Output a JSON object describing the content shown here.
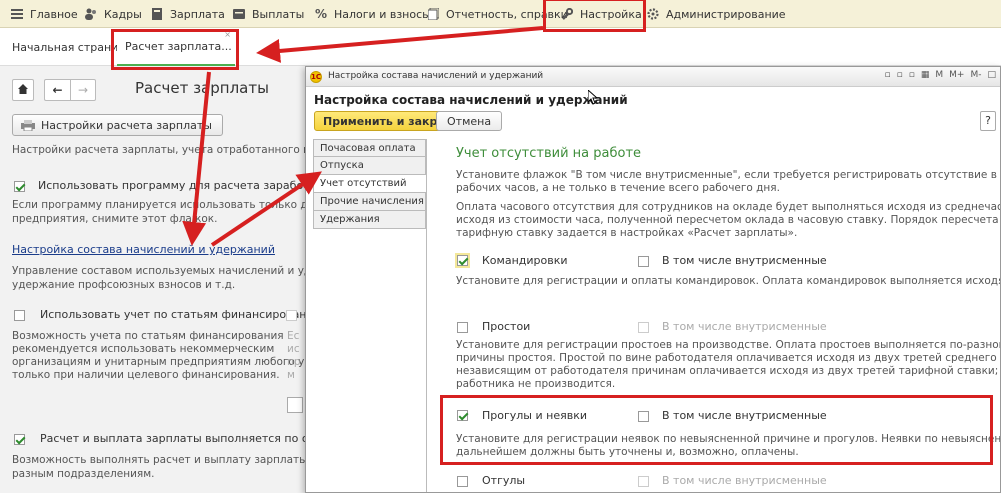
{
  "topmenu": {
    "items": [
      {
        "label": "Главное",
        "icon": "menu-icon"
      },
      {
        "label": "Кадры",
        "icon": "people-icon"
      },
      {
        "label": "Зарплата",
        "icon": "calculator-icon"
      },
      {
        "label": "Выплаты",
        "icon": "wallet-icon"
      },
      {
        "label": "Налоги и взносы",
        "icon": "percent-icon"
      },
      {
        "label": "Отчетность, справки",
        "icon": "report-icon"
      },
      {
        "label": "Настройка",
        "icon": "wrench-icon"
      },
      {
        "label": "Администрирование",
        "icon": "gear-icon"
      }
    ]
  },
  "tabs": {
    "home": "Начальная страница",
    "active": "Расчет зарплата..."
  },
  "leftpage": {
    "title": "Расчет зарплаты",
    "settings_button": "Настройки расчета зарплаты",
    "desc1": "Настройки расчета зарплаты, учета отработанного времени, отс",
    "cb1_label": "Использовать программу для расчета заработной плат",
    "cb1_hint1": "Если программу планируется использовать только для ведения к",
    "cb1_hint2": "предприятия, снимите этот флажок.",
    "link": "Настройка состава начислений и удержаний",
    "link_hint1": "Управление составом используемых начислений и удержаний, у",
    "link_hint2": "удержание профсоюзных взносов и т.д.",
    "cb2_label": "Использовать учет по статьям финансирования",
    "cb2_hint1": "Возможность учета по статьям финансирования",
    "cb2_hint2": "рекомендуется использовать некоммерческим",
    "cb2_hint3": "организациям и унитарным предприятиям любого уровня",
    "cb2_hint4": "только при наличии целевого финансирования.",
    "cb2_side1": "Ес",
    "cb2_side2": "ис",
    "cb2_side3": "пр",
    "cb2_side4": "м",
    "cb3_label": "Расчет и выплата зарплаты выполняется по организации в",
    "cb3_hint1": "Возможность выполнять расчет и выплату зарплаты по всей орга",
    "cb3_hint2": "разным подразделениям."
  },
  "dialog": {
    "window_title": "Настройка состава начислений и удержаний",
    "toolbar_icons": [
      "M",
      "M+",
      "M-"
    ],
    "header": "Настройка состава начислений и удержаний",
    "apply_button": "Применить и закрыть",
    "cancel_button": "Отмена",
    "help_button": "?",
    "sidetabs": [
      "Почасовая оплата",
      "Отпуска",
      "Учет отсутствий",
      "Прочие начисления",
      "Удержания"
    ],
    "section_title": "Учет отсутствий на работе",
    "intro1": "Установите флажок \"В том числе внутрисменные\", если требуется регистрировать отсутствие в течение нескольких",
    "intro2": "рабочих часов, а не только в течение всего рабочего дня.",
    "intro3": "Оплата часового отсутствия для сотрудников на окладе будет выполняться исходя из среднечасового заработка или",
    "intro4": "исходя из стоимости часа, полученной пересчетом оклада в часовую ставку. Порядок пересчета оклада в часовую",
    "intro5": "тарифную ставку задается в настройках «Расчет зарплаты».",
    "trips_label": "Командировки",
    "trips_intra": "В том числе внутрисменные",
    "trips_hint": "Установите для регистрации и оплаты командировок. Оплата командировок выполняется исходя из среднего заработка.",
    "idle_label": "Простои",
    "idle_intra": "В том числе внутрисменные",
    "idle_hint1": "Установите для регистрации простоев на производстве. Оплата простоев выполняется по-разному в зависимости от",
    "idle_hint2": "причины простоя. Простой по вине работодателя оплачивается исходя из двух третей среднего заработка; оплата по",
    "idle_hint3": "независящим от работодателя причинам оплачивается исходя из двух третей тарифной ставки; оплата простоя по вине",
    "idle_hint4": "работника не производится.",
    "absence_label": "Прогулы и неявки",
    "absence_intra": "В том числе внутрисменные",
    "absence_hint1": "Установите для регистрации неявок по невыясненной причине и прогулов. Неявки по невыясненной причине в",
    "absence_hint2": "дальнейшем должны быть уточнены и, возможно, оплачены.",
    "leave_label": "Отгулы",
    "leave_intra": "В том числе внутрисменные"
  },
  "colors": {
    "menu_bg": "#f5f1d8",
    "accent_green": "#3e8d3a",
    "highlight_red": "#d62020",
    "apply_yellow": "#f5d33d"
  }
}
